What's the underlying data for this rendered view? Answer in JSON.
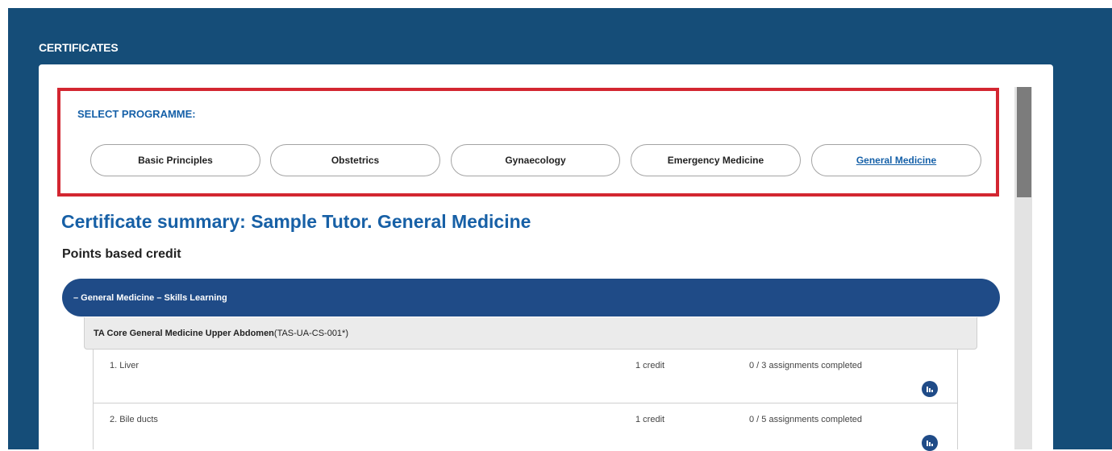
{
  "page": {
    "heading": "CERTIFICATES"
  },
  "programme_selector": {
    "label": "SELECT PROGRAMME:",
    "programmes": [
      {
        "label": "Basic Principles",
        "active": false
      },
      {
        "label": "Obstetrics",
        "active": false
      },
      {
        "label": "Gynaecology",
        "active": false
      },
      {
        "label": "Emergency Medicine",
        "active": false
      },
      {
        "label": "General Medicine",
        "active": true
      }
    ]
  },
  "summary": {
    "title": "Certificate summary: Sample Tutor. General Medicine",
    "subtitle": "Points based credit"
  },
  "section": {
    "label": "– General Medicine – Skills Learning"
  },
  "group": {
    "name": "TA Core General Medicine Upper Abdomen",
    "code": "(TAS-UA-CS-001*)"
  },
  "items": [
    {
      "name": "1. Liver",
      "credit": "1 credit",
      "progress": "0 / 3 assignments completed",
      "icon": "bar-chart-icon"
    },
    {
      "name": "2. Bile ducts",
      "credit": "1 credit",
      "progress": "0 / 5 assignments completed",
      "icon": "bar-chart-icon"
    }
  ],
  "colors": {
    "background": "#154d78",
    "accent_blue": "#1560a8",
    "section_bar": "#1f4b87",
    "highlight_border": "#d32631"
  }
}
